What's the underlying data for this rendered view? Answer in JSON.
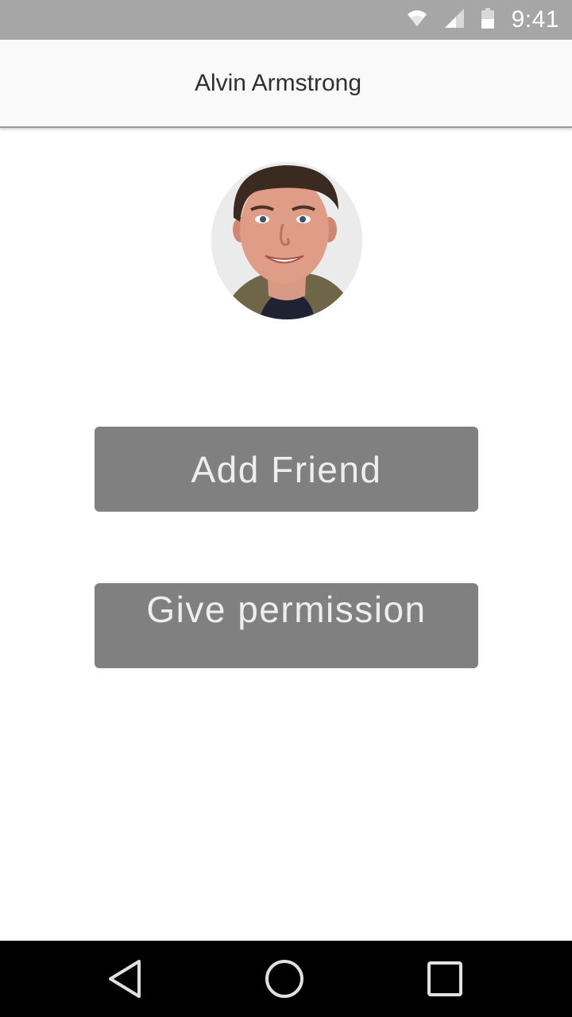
{
  "status_bar": {
    "time": "9:41",
    "icons": [
      "wifi-icon",
      "cell-signal-icon",
      "battery-icon"
    ]
  },
  "app_bar": {
    "title": "Alvin Armstrong"
  },
  "profile": {
    "avatar": "profile-photo"
  },
  "actions": {
    "add_friend_label": "Add Friend",
    "give_permission_label": "Give permission"
  },
  "nav_bar": {
    "icons": [
      "back-icon",
      "home-icon",
      "recents-icon"
    ]
  },
  "colors": {
    "status_bar_bg": "#a6a6a6",
    "app_bar_bg": "#f9f9f9",
    "button_bg": "#808080",
    "button_text": "#eeeeee",
    "nav_bar_bg": "#000000"
  }
}
